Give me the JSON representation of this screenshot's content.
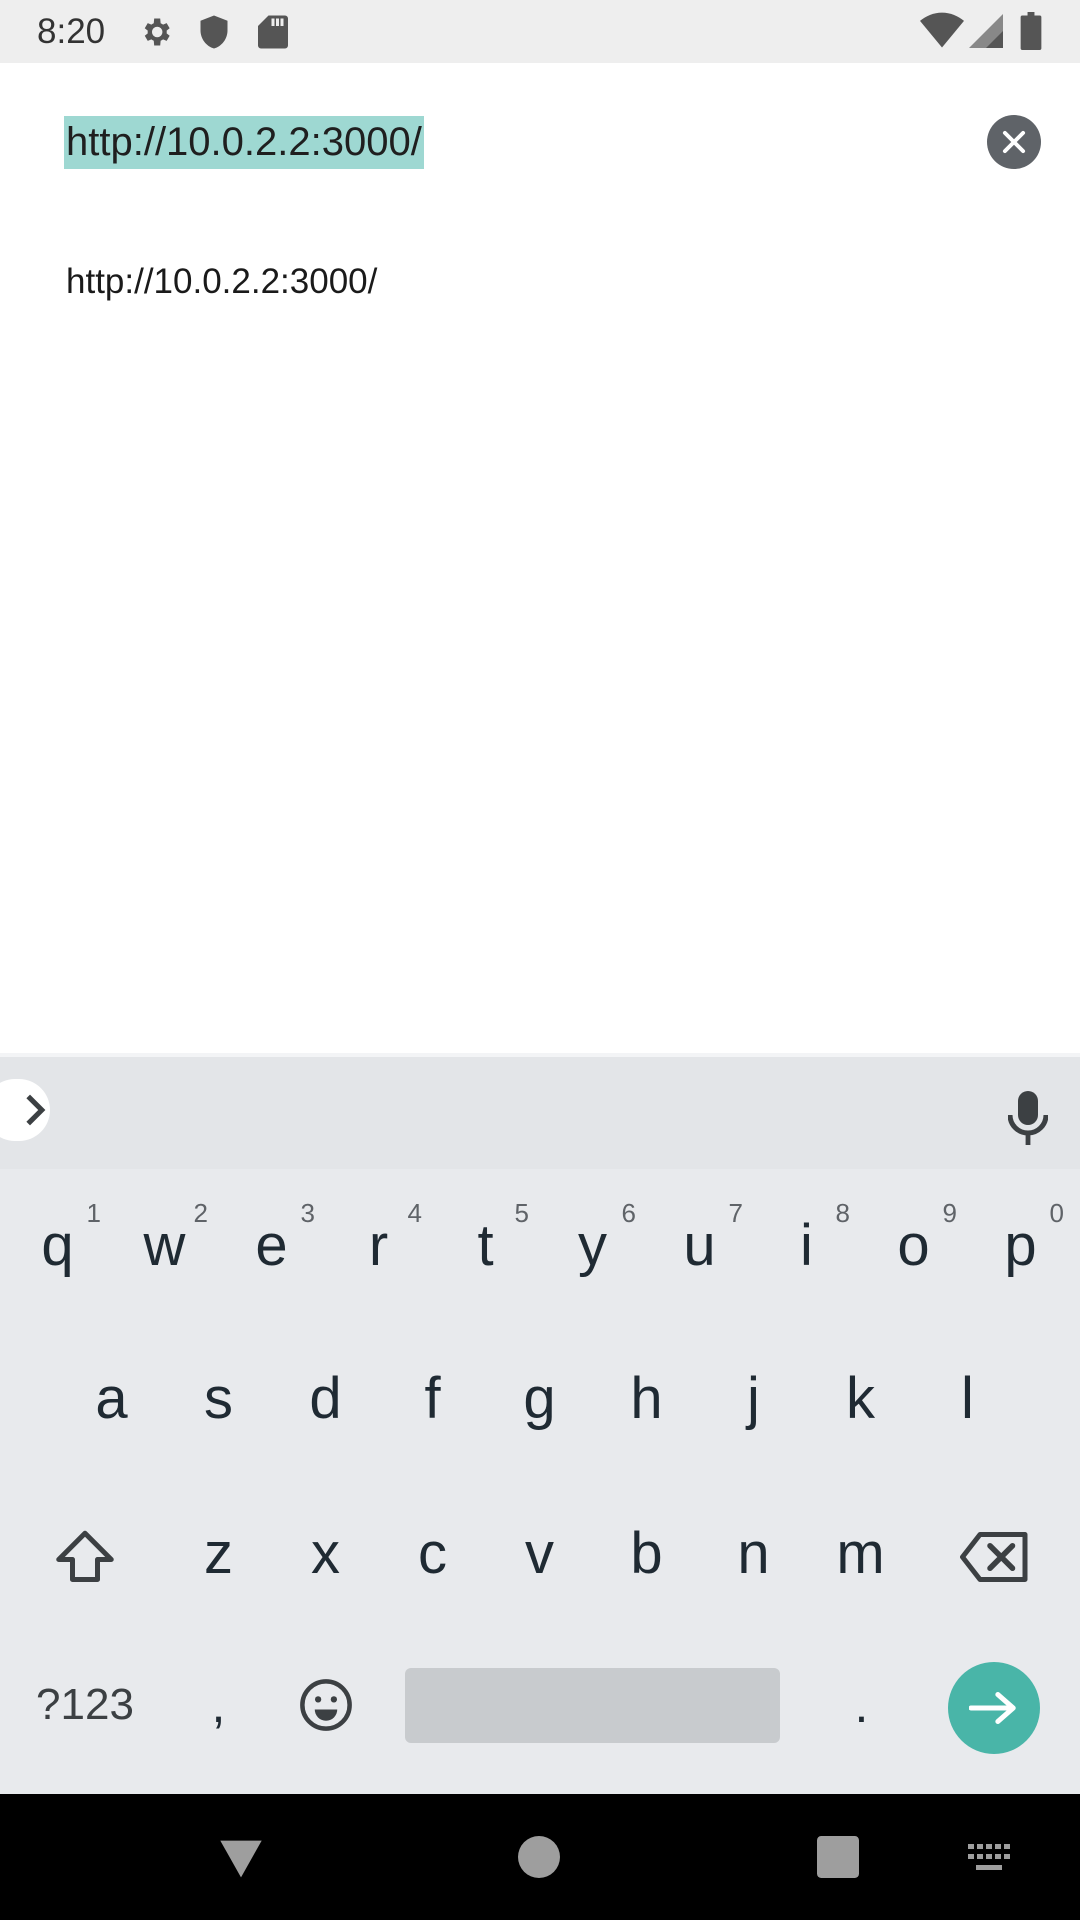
{
  "status_bar": {
    "time": "8:20",
    "left_icons": [
      "gear-icon",
      "shield-icon",
      "sd-card-icon"
    ],
    "right_icons": [
      "wifi-icon",
      "signal-icon",
      "battery-icon"
    ]
  },
  "address": {
    "url_value": "http://10.0.2.2:3000/",
    "selection_color": "#9ed8d2"
  },
  "suggestions": [
    {
      "text": "http://10.0.2.2:3000/"
    }
  ],
  "keyboard": {
    "row1": [
      {
        "key": "q",
        "hint": "1"
      },
      {
        "key": "w",
        "hint": "2"
      },
      {
        "key": "e",
        "hint": "3"
      },
      {
        "key": "r",
        "hint": "4"
      },
      {
        "key": "t",
        "hint": "5"
      },
      {
        "key": "y",
        "hint": "6"
      },
      {
        "key": "u",
        "hint": "7"
      },
      {
        "key": "i",
        "hint": "8"
      },
      {
        "key": "o",
        "hint": "9"
      },
      {
        "key": "p",
        "hint": "0"
      }
    ],
    "row2": [
      "a",
      "s",
      "d",
      "f",
      "g",
      "h",
      "j",
      "k",
      "l"
    ],
    "row3": [
      "z",
      "x",
      "c",
      "v",
      "b",
      "n",
      "m"
    ],
    "symbols_label": "?123",
    "comma": ",",
    "period": ".",
    "accent_color": "#49b5a8"
  }
}
